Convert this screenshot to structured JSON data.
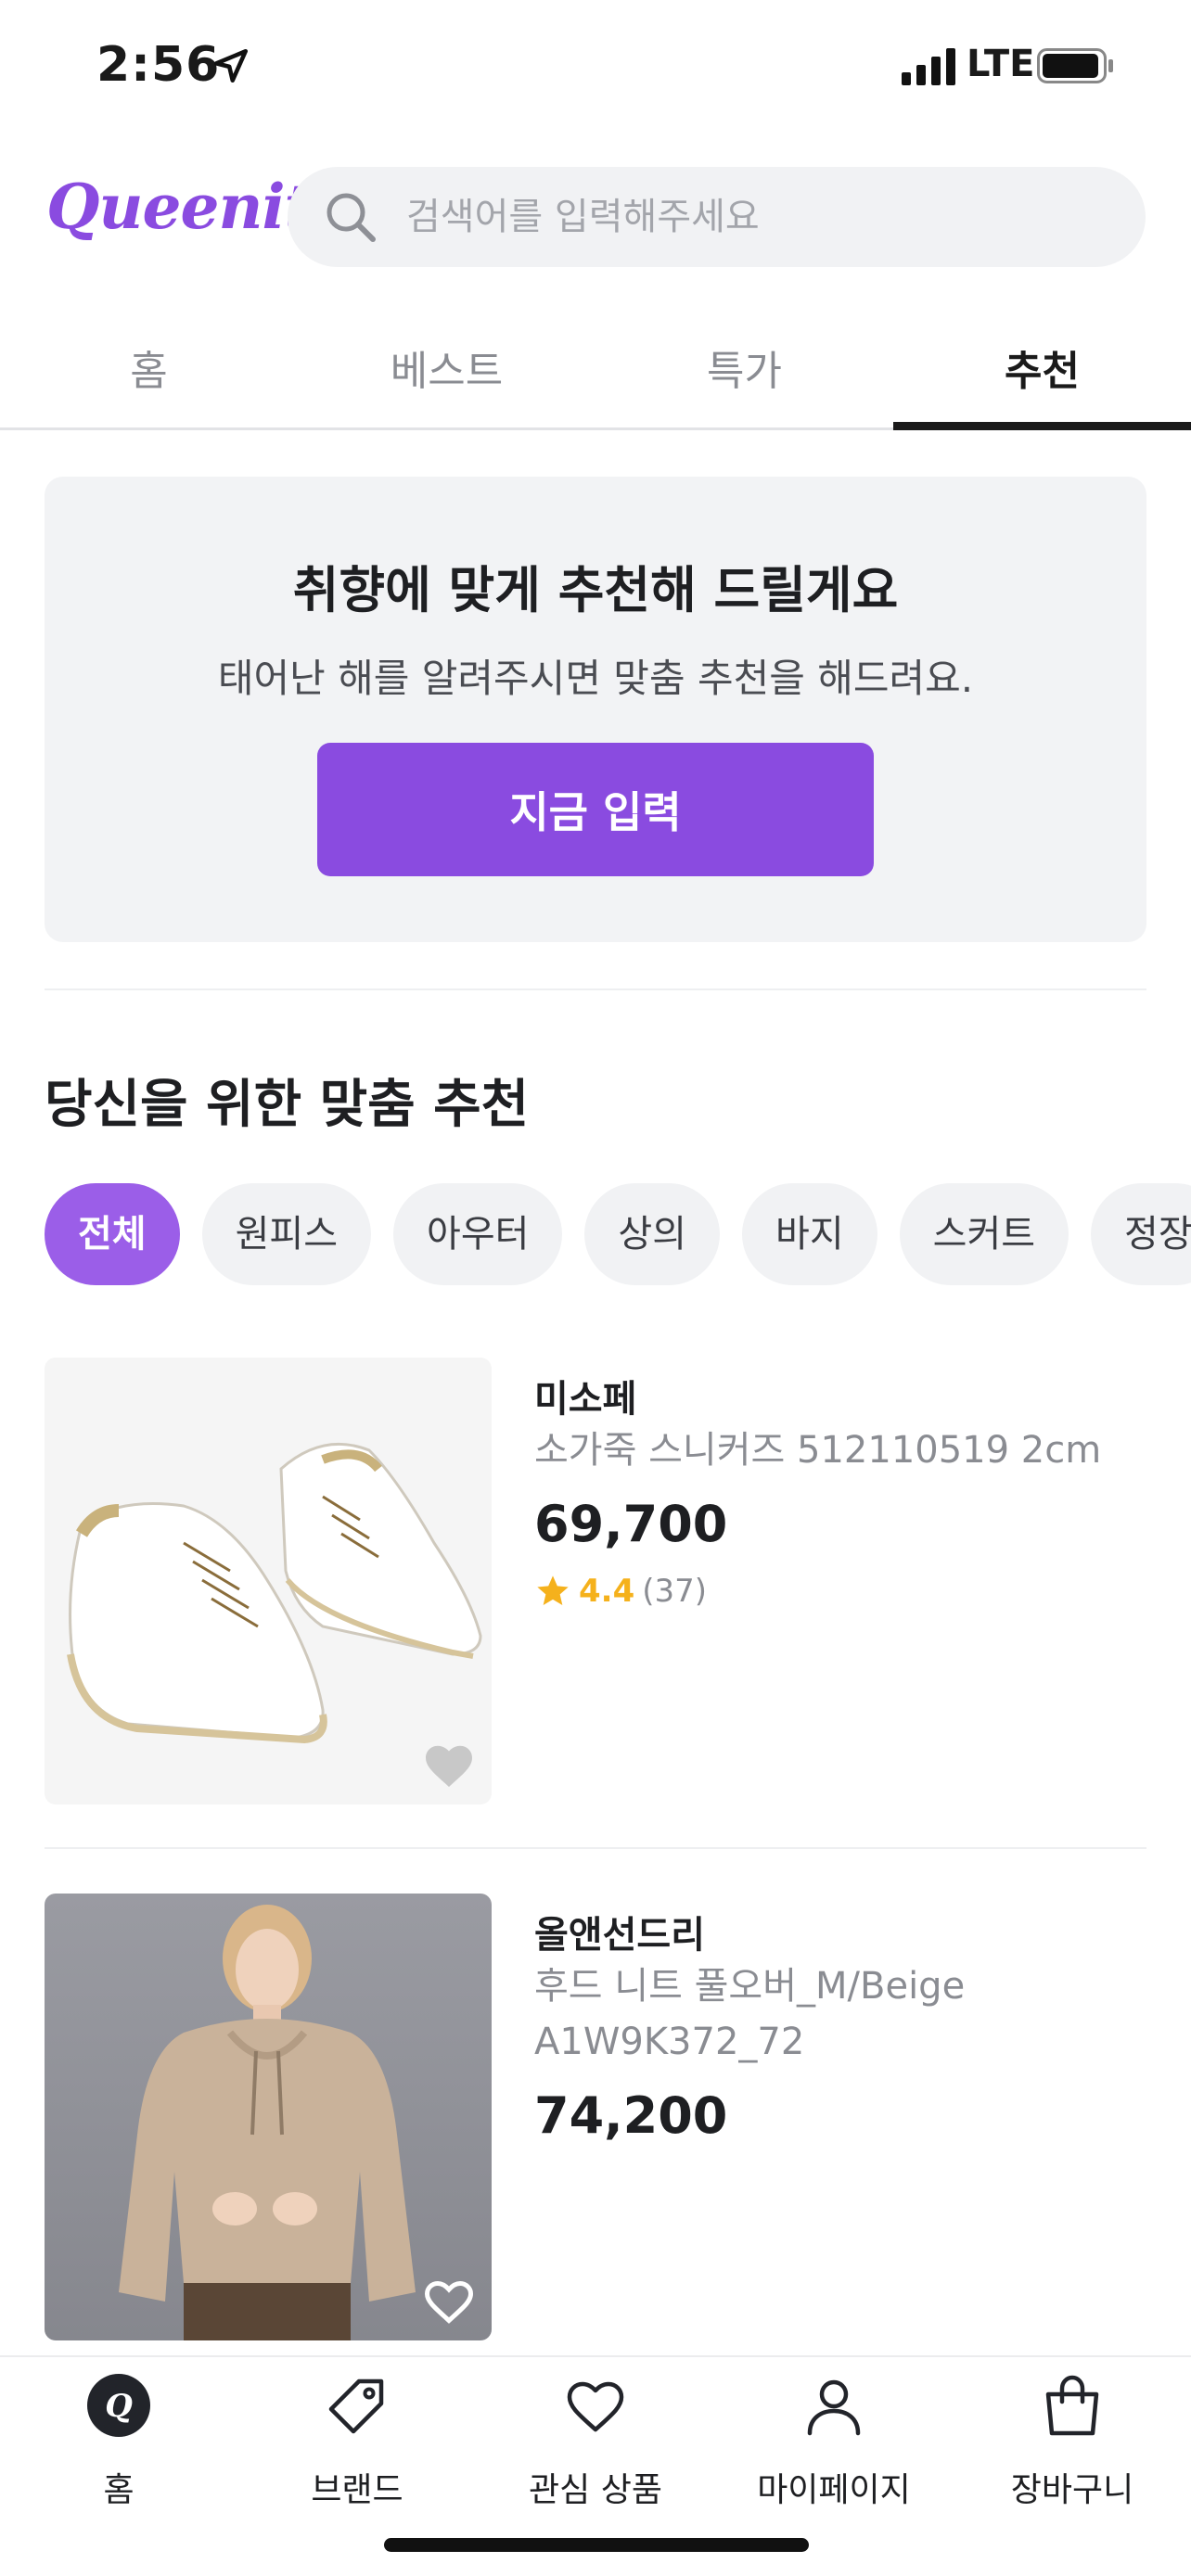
{
  "status_bar": {
    "time": "2:56",
    "network": "LTE"
  },
  "header": {
    "logo": "Queenit",
    "search_placeholder": "검색어를 입력해주세요"
  },
  "tabs": [
    {
      "label": "홈",
      "active": false
    },
    {
      "label": "베스트",
      "active": false
    },
    {
      "label": "특가",
      "active": false
    },
    {
      "label": "추천",
      "active": true
    }
  ],
  "promo": {
    "title": "취향에 맞게 추천해 드릴게요",
    "subtitle": "태어난 해를 알려주시면 맞춤 추천을 해드려요.",
    "button_label": "지금 입력"
  },
  "recommend": {
    "title": "당신을 위한 맞춤 추천",
    "chips": [
      "전체",
      "원피스",
      "아우터",
      "상의",
      "바지",
      "스커트",
      "정장"
    ],
    "active_chip": "전체"
  },
  "products": [
    {
      "brand": "미소페",
      "name": "소가죽 스니커즈 512110519 2cm",
      "price": "69,700",
      "rating": "4.4",
      "review_count": "(37)",
      "icon": "sneakers-image"
    },
    {
      "brand": "올앤선드리",
      "name": "후드 니트 풀오버_M/Beige A1W9K372_72",
      "price": "74,200",
      "icon": "knit-hoodie-image"
    }
  ],
  "bottom_nav": [
    {
      "label": "홈",
      "icon": "queenit-home-icon"
    },
    {
      "label": "브랜드",
      "icon": "tag-icon"
    },
    {
      "label": "관심 상품",
      "icon": "heart-icon"
    },
    {
      "label": "마이페이지",
      "icon": "person-icon"
    },
    {
      "label": "장바구니",
      "icon": "shopping-bag-icon"
    }
  ],
  "colors": {
    "accent": "#8a4be0",
    "chip_active": "#9b5ee8",
    "star": "#f5b11c"
  }
}
